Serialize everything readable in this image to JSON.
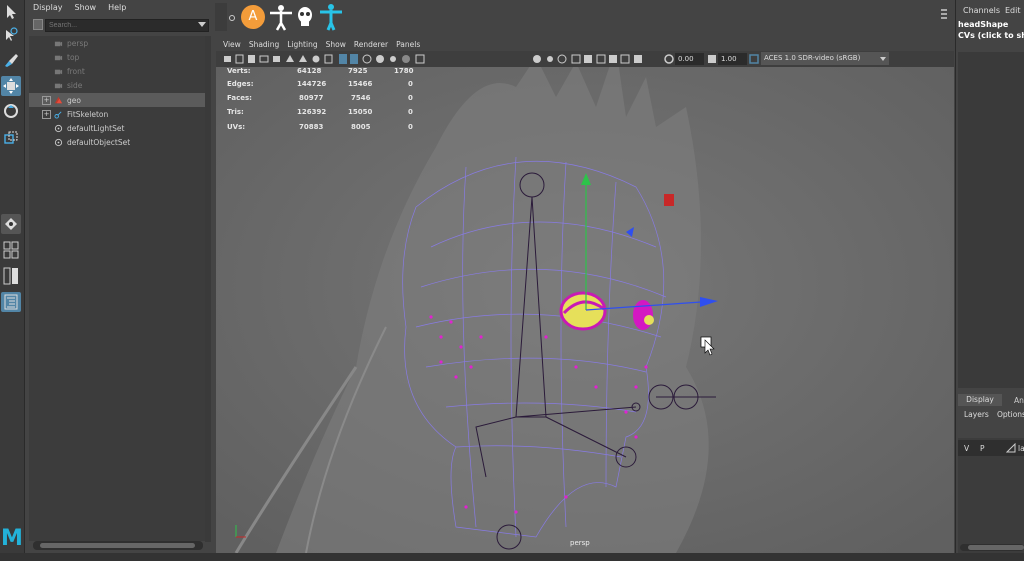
{
  "outliner": {
    "menu": [
      "Display",
      "Show",
      "Help"
    ],
    "search_placeholder": "Search...",
    "items": [
      {
        "label": "persp",
        "dim": true
      },
      {
        "label": "top",
        "dim": true
      },
      {
        "label": "front",
        "dim": true
      },
      {
        "label": "side",
        "dim": true
      },
      {
        "label": "geo",
        "expandable": true,
        "selected": true
      },
      {
        "label": "FitSkeleton",
        "expandable": true
      },
      {
        "label": "defaultLightSet"
      },
      {
        "label": "defaultObjectSet"
      }
    ]
  },
  "shelf": {
    "icons": [
      "diamond-icon",
      "a-circle-icon",
      "t-pose-figure-icon",
      "skull-icon",
      "t-pose-figure-cyan-icon"
    ],
    "a_letter": "A"
  },
  "viewport": {
    "menu": [
      "View",
      "Shading",
      "Lighting",
      "Show",
      "Renderer",
      "Panels"
    ],
    "exposure": "0.00",
    "gamma": "1.00",
    "color_space": "ACES 1.0 SDR-video (sRGB)",
    "camera_label": "persp",
    "hud": [
      {
        "label": "Verts:",
        "v1": "64128",
        "v2": "7925",
        "v3": "1780"
      },
      {
        "label": "Edges:",
        "v1": "144726",
        "v2": "15466",
        "v3": "0"
      },
      {
        "label": "Faces:",
        "v1": "80977",
        "v2": "7546",
        "v3": "0"
      },
      {
        "label": "Tris:",
        "v1": "126392",
        "v2": "15050",
        "v3": "0"
      },
      {
        "label": "UVs:",
        "v1": "70883",
        "v2": "8005",
        "v3": "0"
      }
    ]
  },
  "channel_box": {
    "tabs": [
      "Channels",
      "Edit"
    ],
    "object_name": "headShape",
    "subtitle": "CVs (click to sh",
    "layer_tabs": [
      "Display",
      "An"
    ],
    "layer_menu": [
      "Layers",
      "Options"
    ],
    "layer_row": {
      "v": "V",
      "p": "P",
      "name": "la"
    }
  },
  "logo_letter": "M"
}
